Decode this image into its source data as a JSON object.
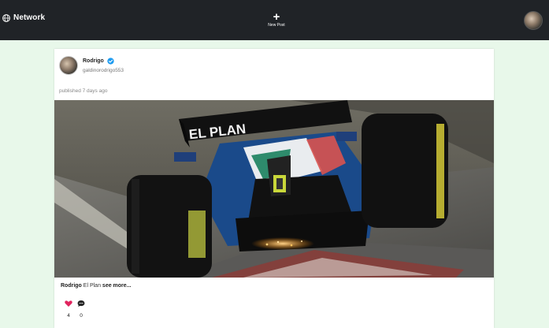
{
  "navbar": {
    "brand": "Network",
    "new_post_label": "New Post",
    "background": "#202327"
  },
  "post": {
    "author_name": "Rodrigo",
    "author_handle": "galdinorodrigo553",
    "verified_icon": "verified-badge-icon",
    "published": "published 7 days ago",
    "image_icon": "formula-one-car-photo",
    "image_text": "EL PLAN",
    "caption_user": "Rodrigo",
    "caption_text": "El Plan",
    "see_more": "see more...",
    "likes": "4",
    "comments": "0"
  },
  "colors": {
    "page_background": "#e8f8ea",
    "card_background": "#ffffff",
    "like_heart": "#e0245e",
    "verified": "#1d9bf0"
  }
}
